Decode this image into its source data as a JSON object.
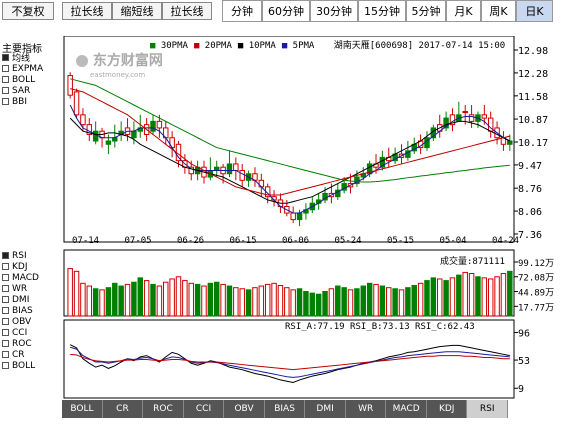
{
  "toolbar": {
    "buttons": [
      "不复权",
      "拉长线",
      "缩短线",
      "拉长线"
    ],
    "periods": [
      "分钟",
      "60分钟",
      "30分钟",
      "15分钟",
      "5分钟",
      "月K",
      "周K",
      "日K"
    ],
    "active_period": "日K"
  },
  "left_panel": {
    "main_title": "主要指标",
    "main_items": [
      {
        "label": "均线",
        "checked": true
      },
      {
        "label": "EXPMA",
        "checked": false
      },
      {
        "label": "BOLL",
        "checked": false
      },
      {
        "label": "SAR",
        "checked": false
      },
      {
        "label": "BBI",
        "checked": false
      }
    ],
    "sub_items": [
      {
        "label": "RSI",
        "checked": true
      },
      {
        "label": "KDJ",
        "checked": false
      },
      {
        "label": "MACD",
        "checked": false
      },
      {
        "label": "WR",
        "checked": false
      },
      {
        "label": "DMI",
        "checked": false
      },
      {
        "label": "BIAS",
        "checked": false
      },
      {
        "label": "OBV",
        "checked": false
      },
      {
        "label": "CCI",
        "checked": false
      },
      {
        "label": "ROC",
        "checked": false
      },
      {
        "label": "CR",
        "checked": false
      },
      {
        "label": "BOLL",
        "checked": false
      }
    ]
  },
  "legend": {
    "stock": "湖南天雁[600698] 2017-07-14 15:00",
    "ma_items": [
      {
        "label": "5PMA",
        "color": "#1a1aa0"
      },
      {
        "label": "10PMA",
        "color": "#000000"
      },
      {
        "label": "20PMA",
        "color": "#c00000"
      },
      {
        "label": "30PMA",
        "color": "#008000"
      }
    ],
    "watermark": "东方财富网",
    "watermark_sub": "eastmoney.com"
  },
  "volume_label": "成交量:871111",
  "rsi_label": "RSI_A:77.19 RSI_B:73.13 RSI_C:62.43",
  "bottom_tabs": [
    "RSI",
    "KDJ",
    "MACD",
    "WR",
    "DMI",
    "BIAS",
    "OBV",
    "CCI",
    "ROC",
    "CR",
    "BOLL"
  ],
  "active_tab": "RSI",
  "colors": {
    "up": "#d00000",
    "down": "#008000",
    "accent": "#c8d8f0"
  },
  "chart_data": [
    {
      "type": "candlestick",
      "title": "湖南天雁[600698] 2017-07-14 15:00",
      "yticks": [
        "12.98",
        "12.28",
        "11.58",
        "10.87",
        "10.17",
        "9.47",
        "8.76",
        "8.06",
        "7.36"
      ],
      "ylim": [
        7.36,
        12.98
      ],
      "xticks": [
        "07-14",
        "07-05",
        "06-26",
        "06-15",
        "06-06",
        "05-24",
        "05-15",
        "05-04",
        "04-24"
      ],
      "x_direction": "newest-left",
      "candles_newest_first": [
        [
          11.6,
          12.3,
          11.5,
          12.2
        ],
        [
          11.0,
          11.8,
          10.9,
          11.7
        ],
        [
          10.7,
          11.2,
          10.5,
          11.0
        ],
        [
          10.4,
          10.9,
          10.2,
          10.7
        ],
        [
          10.5,
          10.8,
          10.1,
          10.2
        ],
        [
          10.3,
          10.6,
          10.0,
          10.5
        ],
        [
          10.2,
          10.4,
          9.8,
          10.1
        ],
        [
          10.3,
          10.7,
          10.0,
          10.2
        ],
        [
          10.5,
          10.8,
          10.2,
          10.4
        ],
        [
          10.4,
          10.9,
          10.2,
          10.6
        ],
        [
          10.5,
          10.8,
          10.1,
          10.3
        ],
        [
          10.6,
          11.0,
          10.3,
          10.5
        ],
        [
          10.4,
          10.9,
          10.2,
          10.7
        ],
        [
          10.8,
          11.0,
          10.4,
          10.5
        ],
        [
          10.6,
          11.0,
          10.3,
          10.8
        ],
        [
          10.3,
          10.8,
          10.1,
          10.6
        ],
        [
          10.0,
          10.5,
          9.7,
          10.3
        ],
        [
          9.6,
          10.2,
          9.4,
          10.1
        ],
        [
          9.4,
          9.8,
          9.2,
          9.6
        ],
        [
          9.2,
          9.6,
          9.0,
          9.4
        ],
        [
          9.4,
          9.6,
          9.0,
          9.2
        ],
        [
          9.1,
          9.6,
          8.9,
          9.4
        ],
        [
          9.3,
          9.7,
          9.0,
          9.1
        ],
        [
          9.4,
          9.6,
          9.1,
          9.3
        ],
        [
          9.2,
          9.5,
          8.9,
          9.4
        ],
        [
          9.5,
          9.9,
          9.1,
          9.2
        ],
        [
          9.3,
          9.7,
          9.0,
          9.5
        ],
        [
          9.0,
          9.5,
          8.8,
          9.3
        ],
        [
          9.2,
          9.3,
          8.8,
          9.0
        ],
        [
          9.0,
          9.4,
          8.8,
          9.2
        ],
        [
          8.8,
          9.2,
          8.5,
          9.0
        ],
        [
          8.5,
          8.9,
          8.3,
          8.8
        ],
        [
          8.4,
          8.7,
          8.2,
          8.5
        ],
        [
          8.2,
          8.6,
          8.0,
          8.4
        ],
        [
          8.0,
          8.4,
          7.9,
          8.2
        ],
        [
          7.8,
          8.2,
          7.7,
          8.0
        ],
        [
          8.0,
          8.1,
          7.6,
          7.8
        ],
        [
          8.1,
          8.3,
          7.8,
          8.0
        ],
        [
          8.3,
          8.5,
          8.0,
          8.1
        ],
        [
          8.4,
          8.6,
          8.1,
          8.3
        ],
        [
          8.6,
          8.8,
          8.3,
          8.4
        ],
        [
          8.5,
          8.9,
          8.3,
          8.6
        ],
        [
          8.7,
          8.9,
          8.4,
          8.5
        ],
        [
          8.9,
          9.1,
          8.6,
          8.7
        ],
        [
          8.8,
          9.2,
          8.6,
          8.9
        ],
        [
          9.1,
          9.3,
          8.8,
          8.9
        ],
        [
          9.2,
          9.4,
          9.0,
          9.1
        ],
        [
          9.5,
          9.6,
          9.1,
          9.2
        ],
        [
          9.4,
          9.8,
          9.2,
          9.5
        ],
        [
          9.7,
          9.9,
          9.3,
          9.4
        ],
        [
          9.6,
          10.0,
          9.4,
          9.7
        ],
        [
          9.8,
          10.0,
          9.5,
          9.6
        ],
        [
          9.7,
          10.1,
          9.5,
          9.8
        ],
        [
          9.9,
          10.2,
          9.6,
          9.7
        ],
        [
          10.1,
          10.3,
          9.8,
          9.9
        ],
        [
          10.0,
          10.4,
          9.8,
          10.2
        ],
        [
          10.3,
          10.5,
          9.9,
          10.0
        ],
        [
          10.6,
          10.7,
          10.2,
          10.3
        ],
        [
          10.5,
          11.0,
          10.3,
          10.7
        ],
        [
          10.9,
          11.1,
          10.5,
          10.6
        ],
        [
          10.7,
          11.2,
          10.5,
          11.0
        ],
        [
          11.0,
          11.4,
          10.8,
          10.8
        ],
        [
          11.1,
          11.3,
          10.7,
          11.1
        ],
        [
          10.8,
          11.3,
          10.6,
          11.0
        ],
        [
          11.0,
          11.1,
          10.6,
          10.8
        ],
        [
          10.9,
          11.3,
          10.7,
          11.0
        ],
        [
          10.5,
          11.1,
          10.3,
          10.9
        ],
        [
          10.3,
          10.8,
          10.1,
          10.6
        ],
        [
          10.1,
          10.5,
          9.9,
          10.3
        ],
        [
          10.2,
          10.4,
          9.9,
          10.1
        ]
      ],
      "ma_series": [
        {
          "name": "5PMA",
          "values_newest_first": [
            11.3,
            10.9,
            10.6,
            10.5,
            10.4,
            10.3,
            10.3,
            10.3,
            10.4,
            10.5,
            10.5,
            10.6,
            10.6,
            10.6,
            10.5,
            10.3,
            10.0,
            9.7,
            9.5,
            9.35,
            9.3,
            9.3,
            9.3,
            9.3,
            9.3,
            9.3,
            9.3,
            9.2,
            9.1,
            9.0,
            8.8,
            8.6,
            8.4,
            8.2,
            8.1,
            8.0,
            8.0,
            8.1,
            8.2,
            8.3,
            8.45,
            8.55,
            8.65,
            8.75,
            8.85,
            8.95,
            9.05,
            9.2,
            9.3,
            9.45,
            9.55,
            9.65,
            9.75,
            9.85,
            9.95,
            10.05,
            10.2,
            10.35,
            10.5,
            10.65,
            10.8,
            10.9,
            10.95,
            10.95,
            10.9,
            10.8,
            10.6,
            10.45,
            10.3,
            10.2
          ]
        },
        {
          "name": "10PMA",
          "values_newest_first": [
            10.9,
            10.7,
            10.5,
            10.45,
            10.4,
            10.4,
            10.45,
            10.45,
            10.4,
            10.35,
            10.25,
            10.1,
            10.0,
            9.9,
            9.8,
            9.7,
            9.6,
            9.5,
            9.4,
            9.35,
            9.3,
            9.25,
            9.2,
            9.15,
            9.1,
            9.0,
            8.9,
            8.8,
            8.7,
            8.6,
            8.5,
            8.4,
            8.35,
            8.3,
            8.3,
            8.35,
            8.4,
            8.45,
            8.5,
            8.6,
            8.7,
            8.8,
            8.9,
            9.0,
            9.1,
            9.2,
            9.3,
            9.4,
            9.5,
            9.6,
            9.7,
            9.8,
            9.9,
            10.0,
            10.1,
            10.2,
            10.35,
            10.5,
            10.6,
            10.7,
            10.75,
            10.8,
            10.8,
            10.75,
            10.7,
            10.6,
            10.5,
            10.4,
            10.3,
            10.2
          ]
        },
        {
          "name": "20PMA",
          "values_newest_first": [
            11.8,
            11.75,
            11.7,
            11.6,
            11.5,
            11.4,
            11.3,
            11.2,
            11.1,
            11.0,
            10.85,
            10.7,
            10.55,
            10.4,
            10.25,
            10.1,
            9.95,
            9.8,
            9.65,
            9.5,
            9.4,
            9.3,
            9.2,
            9.1,
            9.0,
            8.9,
            8.8,
            8.75,
            8.7,
            8.65,
            8.6,
            8.55,
            8.55,
            8.55,
            8.6,
            8.65,
            8.7,
            8.75,
            8.8,
            8.85,
            8.9,
            8.95,
            9.0,
            9.05,
            9.1,
            9.15,
            9.2,
            9.25,
            9.3,
            9.35,
            9.4,
            9.45,
            9.5,
            9.55,
            9.6,
            9.65,
            9.7,
            9.75,
            9.8,
            9.85,
            9.9,
            9.95,
            10.0,
            10.05,
            10.1,
            10.15,
            10.2,
            10.25,
            10.3,
            10.35
          ]
        },
        {
          "name": "30PMA",
          "values_newest_first": [
            12.1,
            12.05,
            12.0,
            11.95,
            11.9,
            11.8,
            11.7,
            11.6,
            11.5,
            11.4,
            11.3,
            11.2,
            11.1,
            11.0,
            10.9,
            10.8,
            10.7,
            10.6,
            10.5,
            10.4,
            10.3,
            10.2,
            10.1,
            10.0,
            9.95,
            9.9,
            9.85,
            9.8,
            9.75,
            9.7,
            9.65,
            9.6,
            9.55,
            9.5,
            9.45,
            9.4,
            9.35,
            9.3,
            9.25,
            9.2,
            9.15,
            9.1,
            9.05,
            9.0,
            8.98,
            8.96,
            8.95,
            8.95,
            8.96,
            8.98,
            9.0,
            9.02,
            9.05,
            9.08,
            9.1,
            9.13,
            9.15,
            9.18,
            9.2,
            9.23,
            9.25,
            9.28,
            9.3,
            9.33,
            9.35,
            9.38,
            9.4,
            9.42,
            9.44,
            9.46
          ]
        }
      ]
    },
    {
      "type": "bar",
      "title": "成交量:871111",
      "yticks": [
        "99.12万",
        "72.08万",
        "44.89万",
        "17.77万"
      ],
      "ylim": [
        0,
        99.12
      ],
      "unit": "万",
      "values_newest_first": [
        87,
        82,
        60,
        55,
        50,
        48,
        52,
        60,
        55,
        58,
        62,
        70,
        65,
        58,
        55,
        62,
        68,
        72,
        65,
        60,
        58,
        55,
        60,
        62,
        58,
        55,
        52,
        50,
        48,
        52,
        55,
        58,
        60,
        56,
        52,
        48,
        50,
        45,
        42,
        40,
        45,
        50,
        55,
        52,
        48,
        50,
        55,
        60,
        58,
        55,
        52,
        50,
        48,
        52,
        56,
        60,
        65,
        70,
        68,
        65,
        70,
        75,
        80,
        78,
        72,
        70,
        68,
        72,
        78,
        82
      ],
      "up_newest_first": [
        true,
        true,
        true,
        true,
        false,
        true,
        false,
        false,
        false,
        true,
        false,
        false,
        true,
        false,
        true,
        true,
        true,
        true,
        true,
        true,
        false,
        true,
        false,
        false,
        true,
        false,
        true,
        true,
        false,
        true,
        true,
        true,
        true,
        true,
        true,
        true,
        false,
        false,
        false,
        false,
        false,
        true,
        false,
        false,
        true,
        false,
        false,
        false,
        true,
        false,
        true,
        false,
        true,
        false,
        false,
        true,
        false,
        false,
        true,
        false,
        true,
        false,
        true,
        true,
        false,
        true,
        true,
        true,
        true,
        false
      ]
    },
    {
      "type": "line",
      "title": "RSI_A:77.19 RSI_B:73.13 RSI_C:62.43",
      "yticks": [
        "96",
        "53",
        "9"
      ],
      "ylim": [
        0,
        100
      ],
      "series": [
        {
          "name": "RSI_A",
          "color": "#000000",
          "values_newest_first": [
            77,
            72,
            55,
            48,
            42,
            45,
            40,
            44,
            50,
            55,
            52,
            58,
            60,
            55,
            50,
            58,
            65,
            62,
            55,
            48,
            45,
            48,
            52,
            50,
            46,
            42,
            40,
            38,
            35,
            32,
            30,
            28,
            25,
            22,
            20,
            18,
            22,
            25,
            28,
            30,
            32,
            35,
            38,
            40,
            42,
            45,
            48,
            50,
            52,
            55,
            58,
            60,
            62,
            65,
            66,
            68,
            70,
            72,
            74,
            75,
            76,
            76,
            74,
            72,
            70,
            68,
            66,
            64,
            62,
            60
          ]
        },
        {
          "name": "RSI_B",
          "color": "#1a1aa0",
          "values_newest_first": [
            73,
            70,
            60,
            55,
            50,
            50,
            48,
            50,
            52,
            55,
            54,
            56,
            57,
            55,
            52,
            55,
            58,
            57,
            54,
            50,
            48,
            49,
            50,
            49,
            47,
            45,
            43,
            41,
            39,
            37,
            35,
            33,
            31,
            29,
            27,
            26,
            27,
            29,
            31,
            33,
            35,
            37,
            39,
            41,
            43,
            45,
            47,
            49,
            51,
            53,
            55,
            57,
            58,
            60,
            61,
            62,
            63,
            64,
            65,
            66,
            66,
            66,
            65,
            64,
            63,
            62,
            61,
            60,
            59,
            58
          ]
        },
        {
          "name": "RSI_C",
          "color": "#c00000",
          "values_newest_first": [
            62,
            61,
            57,
            54,
            52,
            51,
            50,
            51,
            52,
            53,
            53,
            54,
            54,
            53,
            52,
            53,
            54,
            54,
            53,
            51,
            50,
            50,
            50,
            50,
            49,
            48,
            47,
            46,
            45,
            44,
            43,
            42,
            41,
            40,
            39,
            38,
            39,
            40,
            41,
            42,
            43,
            44,
            45,
            46,
            47,
            48,
            49,
            50,
            51,
            52,
            53,
            54,
            55,
            56,
            57,
            58,
            59,
            59,
            60,
            60,
            60,
            60,
            59,
            59,
            58,
            57,
            57,
            56,
            55,
            55
          ]
        }
      ]
    }
  ]
}
